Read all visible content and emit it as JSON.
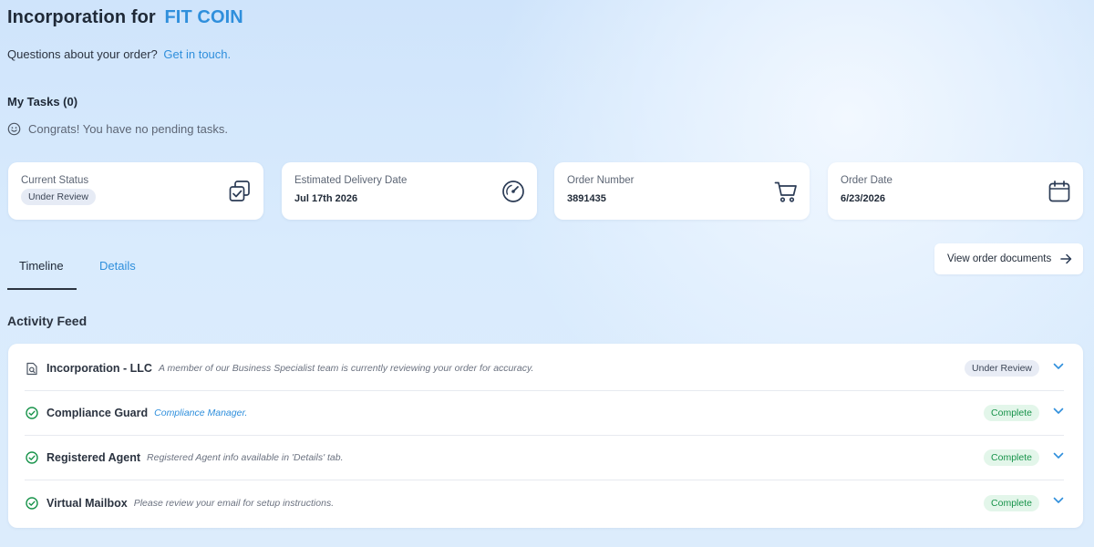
{
  "header": {
    "title_prefix": "Incorporation for",
    "company_name": "FIT COIN",
    "questions_text": "Questions about your order?",
    "contact_link": "Get in touch."
  },
  "tasks": {
    "heading": "My Tasks (0)",
    "empty_message": "Congrats! You have no pending tasks."
  },
  "summary_cards": [
    {
      "label": "Current Status",
      "value": "Under Review",
      "icon": "copy-check-icon"
    },
    {
      "label": "Estimated Delivery Date",
      "value": "Jul 17th 2026",
      "icon": "speedometer-icon"
    },
    {
      "label": "Order Number",
      "value": "3891435",
      "icon": "cart-icon"
    },
    {
      "label": "Order Date",
      "value": "6/23/2026",
      "icon": "calendar-icon"
    }
  ],
  "tabs": [
    {
      "label": "Timeline",
      "active": true
    },
    {
      "label": "Details",
      "active": false
    }
  ],
  "view_documents_label": "View order documents",
  "activity": {
    "heading": "Activity Feed",
    "items": [
      {
        "name": "Incorporation - LLC",
        "description": "A member of our Business Specialist team is currently reviewing your order for accuracy.",
        "status": "Under Review",
        "icon": "document-search-icon"
      },
      {
        "name": "Compliance Guard",
        "description": "Compliance Manager.",
        "status": "Complete",
        "icon": "check-circle-icon"
      },
      {
        "name": "Registered Agent",
        "description": "Registered Agent info available in 'Details' tab.",
        "status": "Complete",
        "icon": "check-circle-icon"
      },
      {
        "name": "Virtual Mailbox",
        "description": "Please review your email for setup instructions.",
        "status": "Complete",
        "icon": "check-circle-icon"
      }
    ]
  },
  "colors": {
    "accent": "#2f8fdc",
    "complete_green": "#17934a",
    "text_dark": "#1f2937"
  }
}
